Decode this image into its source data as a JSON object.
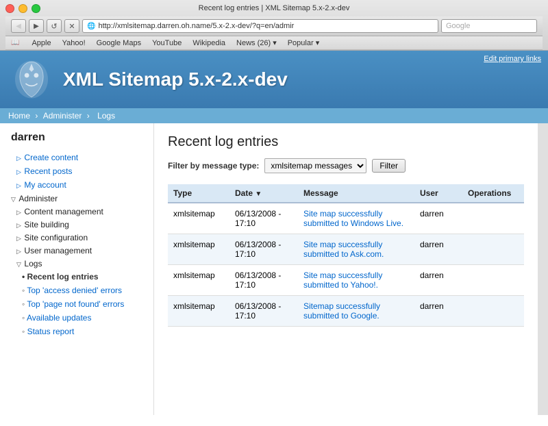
{
  "window": {
    "title": "Recent log entries | XML Sitemap 5.x-2.x-dev"
  },
  "toolbar": {
    "back_label": "◀",
    "forward_label": "▶",
    "refresh_label": "↺",
    "stop_label": "✕",
    "address": "http://xmlsitemap.darren.oh.name/5.x-2.x-dev/?q=en/admir",
    "search_placeholder": "Google"
  },
  "bookmarks": [
    {
      "label": "Apple"
    },
    {
      "label": "Yahoo!"
    },
    {
      "label": "Google Maps"
    },
    {
      "label": "YouTube"
    },
    {
      "label": "Wikipedia"
    },
    {
      "label": "News (26) ▾"
    },
    {
      "label": "Popular ▾"
    }
  ],
  "header": {
    "edit_primary_links": "Edit primary links",
    "site_title": "XML Sitemap 5.x-2.x-dev"
  },
  "breadcrumb": {
    "home": "Home",
    "administer": "Administer",
    "logs": "Logs"
  },
  "sidebar": {
    "username": "darren",
    "links": [
      {
        "label": "Create content"
      },
      {
        "label": "Recent posts"
      },
      {
        "label": "My account"
      }
    ],
    "administer_label": "Administer",
    "sub_items": [
      {
        "label": "Content management",
        "type": "subsection"
      },
      {
        "label": "Site building",
        "type": "subsection"
      },
      {
        "label": "Site configuration",
        "type": "subsection"
      },
      {
        "label": "User management",
        "type": "subsection"
      },
      {
        "label": "Logs",
        "type": "subsection-open"
      }
    ],
    "logs_items": [
      {
        "label": "Recent log entries",
        "active": true
      },
      {
        "label": "Top 'access denied' errors"
      },
      {
        "label": "Top 'page not found' errors"
      },
      {
        "label": "Available updates"
      },
      {
        "label": "Status report"
      }
    ]
  },
  "main": {
    "page_heading": "Recent log entries",
    "filter_label": "Filter by message type:",
    "filter_value": "xmlsitemap messages",
    "filter_button": "Filter",
    "table": {
      "headers": [
        "Type",
        "Date",
        "Message",
        "User",
        "Operations"
      ],
      "rows": [
        {
          "type": "xmlsitemap",
          "date": "06/13/2008 - 17:10",
          "message": "Site map successfully submitted to Windows Live.",
          "user": "darren",
          "operations": ""
        },
        {
          "type": "xmlsitemap",
          "date": "06/13/2008 - 17:10",
          "message": "Site map successfully submitted to Ask.com.",
          "user": "darren",
          "operations": ""
        },
        {
          "type": "xmlsitemap",
          "date": "06/13/2008 - 17:10",
          "message": "Site map successfully submitted to Yahoo!.",
          "user": "darren",
          "operations": ""
        },
        {
          "type": "xmlsitemap",
          "date": "06/13/2008 - 17:10",
          "message": "Sitemap successfully submitted to Google.",
          "user": "darren",
          "operations": ""
        }
      ]
    }
  }
}
